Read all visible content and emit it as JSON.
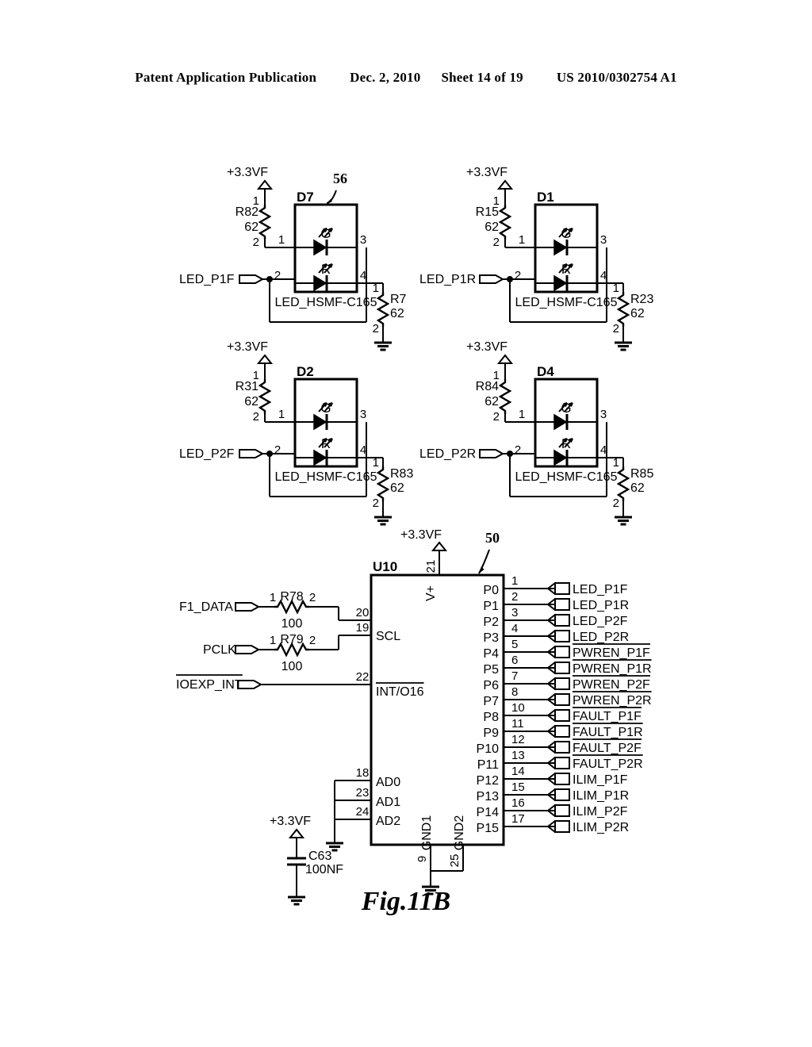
{
  "header": {
    "publication": "Patent Application Publication",
    "date": "Dec. 2, 2010",
    "sheet": "Sheet 14 of 19",
    "number": "US 2010/0302754 A1"
  },
  "figure": {
    "caption": "Fig.11B",
    "ref_numeral_led": "56",
    "ref_numeral_ic": "50"
  },
  "led_circuits": [
    {
      "id": "d7",
      "designator": "D7",
      "part": "LED_HSMF-C165",
      "supply": "+3.3VF",
      "series_resistor": {
        "name": "R82",
        "value": "62",
        "pin_top": "1",
        "pin_bottom": "2"
      },
      "ground_resistor": {
        "name": "R7",
        "value": "62",
        "pin_top": "1",
        "pin_bottom": "2"
      },
      "signal": "LED_P1F",
      "pins": {
        "p1": "1",
        "p2": "2",
        "p3": "3",
        "p4": "4"
      },
      "leds": {
        "green": "G",
        "red": "R"
      },
      "ref": "56"
    },
    {
      "id": "d1",
      "designator": "D1",
      "part": "LED_HSMF-C165",
      "supply": "+3.3VF",
      "series_resistor": {
        "name": "R15",
        "value": "62",
        "pin_top": "1",
        "pin_bottom": "2"
      },
      "ground_resistor": {
        "name": "R23",
        "value": "62",
        "pin_top": "1",
        "pin_bottom": "2"
      },
      "signal": "LED_P1R",
      "pins": {
        "p1": "1",
        "p2": "2",
        "p3": "3",
        "p4": "4"
      },
      "leds": {
        "green": "G",
        "red": "R"
      },
      "ref": ""
    },
    {
      "id": "d2",
      "designator": "D2",
      "part": "LED_HSMF-C165",
      "supply": "+3.3VF",
      "series_resistor": {
        "name": "R31",
        "value": "62",
        "pin_top": "1",
        "pin_bottom": "2"
      },
      "ground_resistor": {
        "name": "R83",
        "value": "62",
        "pin_top": "1",
        "pin_bottom": "2"
      },
      "signal": "LED_P2F",
      "pins": {
        "p1": "1",
        "p2": "2",
        "p3": "3",
        "p4": "4"
      },
      "leds": {
        "green": "G",
        "red": "R"
      },
      "ref": ""
    },
    {
      "id": "d4",
      "designator": "D4",
      "part": "LED_HSMF-C165",
      "supply": "+3.3VF",
      "series_resistor": {
        "name": "R84",
        "value": "62",
        "pin_top": "1",
        "pin_bottom": "2"
      },
      "ground_resistor": {
        "name": "R85",
        "value": "62",
        "pin_top": "1",
        "pin_bottom": "2"
      },
      "signal": "LED_P2R",
      "pins": {
        "p1": "1",
        "p2": "2",
        "p3": "3",
        "p4": "4"
      },
      "leds": {
        "green": "G",
        "red": "R"
      },
      "ref": ""
    }
  ],
  "ic": {
    "designator": "U10",
    "supply_label": "+3.3VF",
    "vplus_pin": "21",
    "vplus_name": "V+",
    "inputs": [
      {
        "signal": "F1_DATA",
        "overline": false,
        "resistor": {
          "name": "R78",
          "value": "100",
          "pin_left": "1",
          "pin_right": "2"
        },
        "ic_pin": "20",
        "ic_pin_name": ""
      },
      {
        "signal": "PCLK",
        "overline": false,
        "resistor": {
          "name": "R79",
          "value": "100",
          "pin_left": "1",
          "pin_right": "2"
        },
        "ic_pin": "19",
        "ic_pin_name": "SCL"
      },
      {
        "signal": "IOEXP_INT",
        "overline": true,
        "resistor": null,
        "ic_pin": "22",
        "ic_pin_name": "INT/O16"
      }
    ],
    "address_pins": [
      {
        "pin": "18",
        "name": "AD0"
      },
      {
        "pin": "23",
        "name": "AD1"
      },
      {
        "pin": "24",
        "name": "AD2"
      }
    ],
    "ground_pins": [
      {
        "pin": "9",
        "name": "GND1"
      },
      {
        "pin": "25",
        "name": "GND2"
      }
    ],
    "outputs": [
      {
        "port": "P0",
        "pin": "1",
        "signal": "LED_P1F",
        "overline": false
      },
      {
        "port": "P1",
        "pin": "2",
        "signal": "LED_P1R",
        "overline": false
      },
      {
        "port": "P2",
        "pin": "3",
        "signal": "LED_P2F",
        "overline": false
      },
      {
        "port": "P3",
        "pin": "4",
        "signal": "LED_P2R",
        "overline": false
      },
      {
        "port": "P4",
        "pin": "5",
        "signal": "PWREN_P1F",
        "overline": true
      },
      {
        "port": "P5",
        "pin": "6",
        "signal": "PWREN_P1R",
        "overline": true
      },
      {
        "port": "P6",
        "pin": "7",
        "signal": "PWREN_P2F",
        "overline": true
      },
      {
        "port": "P7",
        "pin": "8",
        "signal": "PWREN_P2R",
        "overline": true
      },
      {
        "port": "P8",
        "pin": "10",
        "signal": "FAULT_P1F",
        "overline": true
      },
      {
        "port": "P9",
        "pin": "11",
        "signal": "FAULT_P1R",
        "overline": true
      },
      {
        "port": "P10",
        "pin": "12",
        "signal": "FAULT_P2F",
        "overline": true
      },
      {
        "port": "P11",
        "pin": "13",
        "signal": "FAULT_P2R",
        "overline": true
      },
      {
        "port": "P12",
        "pin": "14",
        "signal": "ILIM_P1F",
        "overline": false
      },
      {
        "port": "P13",
        "pin": "15",
        "signal": "ILIM_P1R",
        "overline": false
      },
      {
        "port": "P14",
        "pin": "16",
        "signal": "ILIM_P2F",
        "overline": false
      },
      {
        "port": "P15",
        "pin": "17",
        "signal": "ILIM_P2R",
        "overline": false
      }
    ]
  },
  "decoupling": {
    "supply": "+3.3VF",
    "capacitor": {
      "name": "C63",
      "value": "100NF"
    }
  },
  "colors": {
    "ink": "#000000",
    "paper": "#ffffff"
  }
}
